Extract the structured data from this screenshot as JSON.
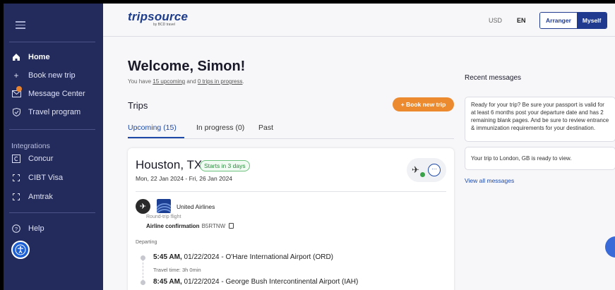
{
  "sidebar": {
    "menu_icon": "hamburger-icon",
    "items": [
      {
        "label": "Home",
        "icon": "home-icon"
      },
      {
        "label": "Book new trip",
        "icon": "plus-icon"
      },
      {
        "label": "Message Center",
        "icon": "mail-icon"
      },
      {
        "label": "Travel program",
        "icon": "shield-icon"
      }
    ],
    "integrations_label": "Integrations",
    "integrations": [
      {
        "label": "Concur",
        "icon": "concur-icon"
      },
      {
        "label": "CIBT Visa",
        "icon": "external-link-icon"
      },
      {
        "label": "Amtrak",
        "icon": "external-link-icon"
      }
    ],
    "help_label": "Help",
    "accessibility_icon": "accessibility-icon"
  },
  "header": {
    "logo_text": "tripsource",
    "logo_sub": "by BCD travel",
    "currency": "USD",
    "language": "EN",
    "toggle": {
      "arranger": "Arranger",
      "myself": "Myself"
    }
  },
  "welcome": {
    "title": "Welcome, Simon!",
    "sub_prefix": "You have ",
    "upcoming_link": "15 upcoming",
    "sub_mid": " and ",
    "inprogress_link": "0 trips in progress",
    "sub_suffix": "."
  },
  "trips": {
    "heading": "Trips",
    "book_button": "+  Book new trip",
    "tabs": [
      "Upcoming (15)",
      "In progress (0)",
      "Past"
    ]
  },
  "trip_card": {
    "city": "Houston, TX",
    "starts_badge": "Starts in 3 days",
    "dates": "Mon, 22 Jan 2024 - Fri, 26 Jan 2024",
    "more_label": "···",
    "airline": "United Airlines",
    "trip_type": "Round-trip flight",
    "confirmation_label": "Airline confirmation",
    "confirmation_code": "B5RTNW",
    "departing_label": "Departing",
    "segment1_time": "5:45 AM,",
    "segment1_rest": " 01/22/2024 - O'Hare International Airport (ORD)",
    "travel_time": "Travel time: 3h 0min",
    "segment2_time": "8:45 AM,",
    "segment2_rest": " 01/22/2024 - George Bush Intercontinental Airport (IAH)"
  },
  "messages": {
    "heading": "Recent messages",
    "items": [
      "Ready for your trip? Be sure your passport is valid for at least 6 months post your departure date and has 2 remaining blank pages. And be sure to review entrance & immunization requirements for your destination.",
      "Your trip to London, GB is ready to view."
    ],
    "view_all": "View all messages"
  }
}
